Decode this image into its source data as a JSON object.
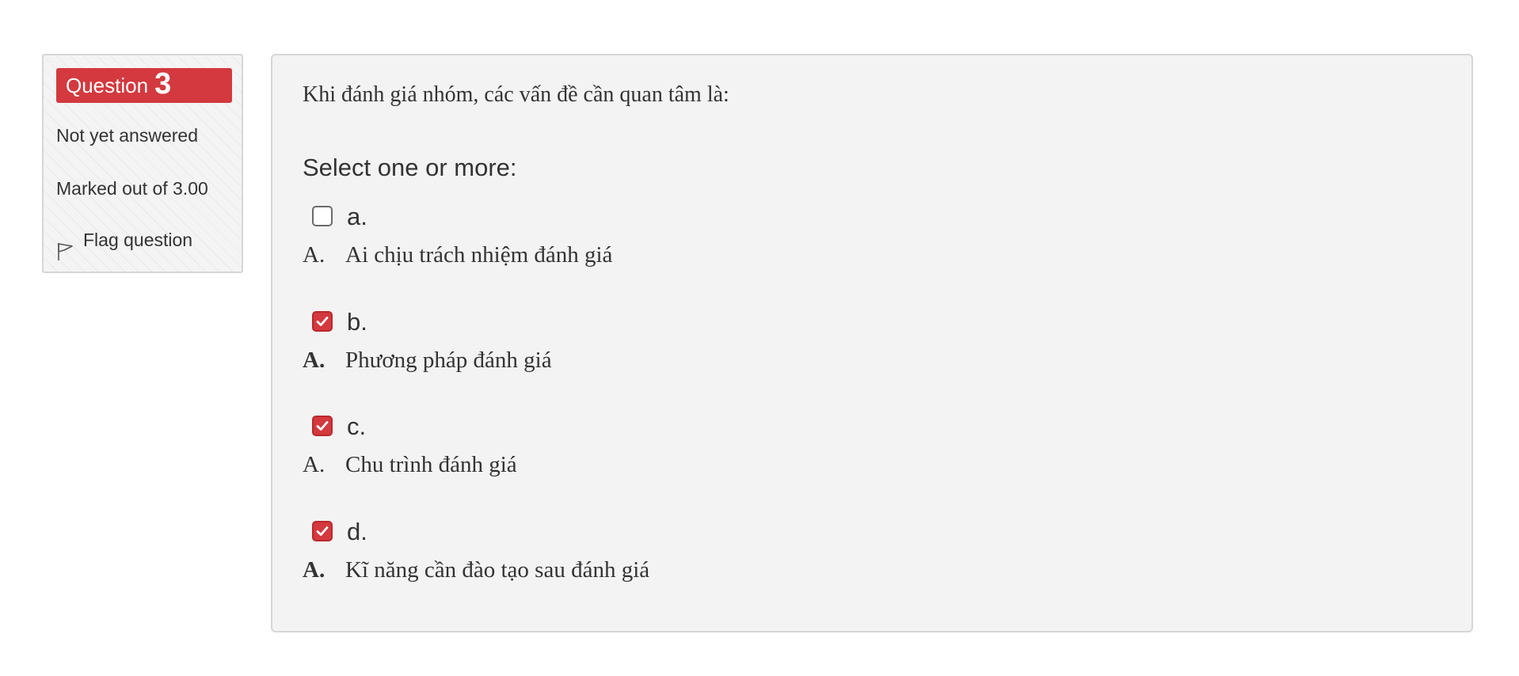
{
  "question_info": {
    "label": "Question",
    "number": "3",
    "state": "Not yet answered",
    "grade": "Marked out of 3.00",
    "flag_label": "Flag question",
    "flag_icon": "flag-outline-icon",
    "badge_color": "#d3393e"
  },
  "question": {
    "text": "Khi đánh giá nhóm, các vấn đề cần quan tâm là:",
    "prompt": "Select one or more:",
    "options": [
      {
        "letter": "a.",
        "marker": "A.",
        "text": "Ai chịu trách nhiệm đánh giá",
        "checked": false
      },
      {
        "letter": "b.",
        "marker": "A.",
        "text": "Phương pháp đánh giá",
        "checked": true
      },
      {
        "letter": "c.",
        "marker": "A.",
        "text": "Chu trình đánh giá",
        "checked": true
      },
      {
        "letter": "d.",
        "marker": "A.",
        "text": "Kĩ năng cần đào tạo sau đánh giá",
        "checked": true
      }
    ]
  },
  "colors": {
    "accent": "#d3393e",
    "panel_bg": "#f3f3f3",
    "border": "#d6d6d6",
    "text": "#333333"
  }
}
